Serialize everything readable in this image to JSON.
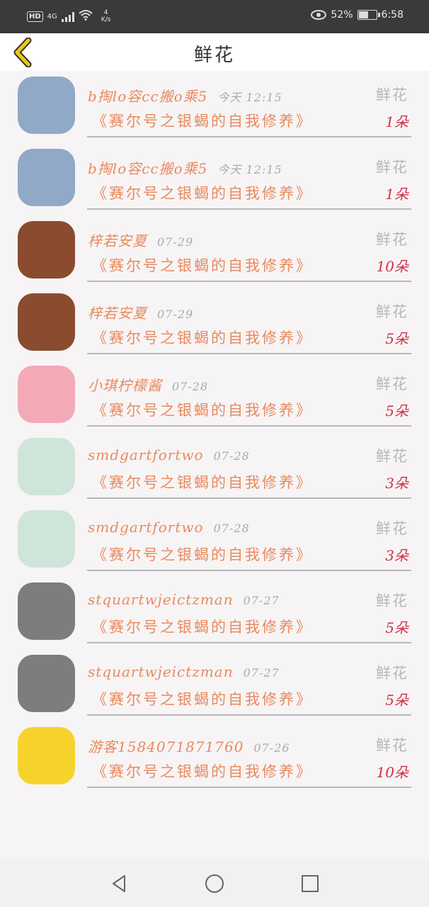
{
  "status_bar": {
    "hd": "HD",
    "network": "4G",
    "speed_value": "4",
    "speed_unit": "K/s",
    "battery": "52%",
    "time": "6:58"
  },
  "header": {
    "title": "鲜花"
  },
  "items": [
    {
      "name": "b掏lo容cc搬o乘5",
      "time": "今天 12:15",
      "gift": "鲜花",
      "book": "《赛尔号之银蝎的自我修养》",
      "count": "1朵",
      "avatar_color": "#8fa9c6"
    },
    {
      "name": "b掏lo容cc搬o乘5",
      "time": "今天 12:15",
      "gift": "鲜花",
      "book": "《赛尔号之银蝎的自我修养》",
      "count": "1朵",
      "avatar_color": "#8fa9c6"
    },
    {
      "name": "梓若安夏",
      "time": "07-29",
      "gift": "鲜花",
      "book": "《赛尔号之银蝎的自我修养》",
      "count": "10朵",
      "avatar_color": "#8a4b2e"
    },
    {
      "name": "梓若安夏",
      "time": "07-29",
      "gift": "鲜花",
      "book": "《赛尔号之银蝎的自我修养》",
      "count": "5朵",
      "avatar_color": "#8a4b2e"
    },
    {
      "name": "小琪柠檬酱",
      "time": "07-28",
      "gift": "鲜花",
      "book": "《赛尔号之银蝎的自我修养》",
      "count": "5朵",
      "avatar_color": "#f4a9b6"
    },
    {
      "name": "smdgartfortwo",
      "time": "07-28",
      "gift": "鲜花",
      "book": "《赛尔号之银蝎的自我修养》",
      "count": "3朵",
      "avatar_color": "#cfe5d9"
    },
    {
      "name": "smdgartfortwo",
      "time": "07-28",
      "gift": "鲜花",
      "book": "《赛尔号之银蝎的自我修养》",
      "count": "3朵",
      "avatar_color": "#cfe5d9"
    },
    {
      "name": "stquartwjeictzman",
      "time": "07-27",
      "gift": "鲜花",
      "book": "《赛尔号之银蝎的自我修养》",
      "count": "5朵",
      "avatar_color": "#7d7d7d"
    },
    {
      "name": "stquartwjeictzman",
      "time": "07-27",
      "gift": "鲜花",
      "book": "《赛尔号之银蝎的自我修养》",
      "count": "5朵",
      "avatar_color": "#7d7d7d"
    },
    {
      "name": "游客1584071871760",
      "time": "07-26",
      "gift": "鲜花",
      "book": "《赛尔号之银蝎的自我修养》",
      "count": "10朵",
      "avatar_color": "#f6d32b"
    }
  ],
  "colors": {
    "accent": "#e88a5e",
    "count": "#d0304a",
    "back_arrow": "#f0c419"
  }
}
